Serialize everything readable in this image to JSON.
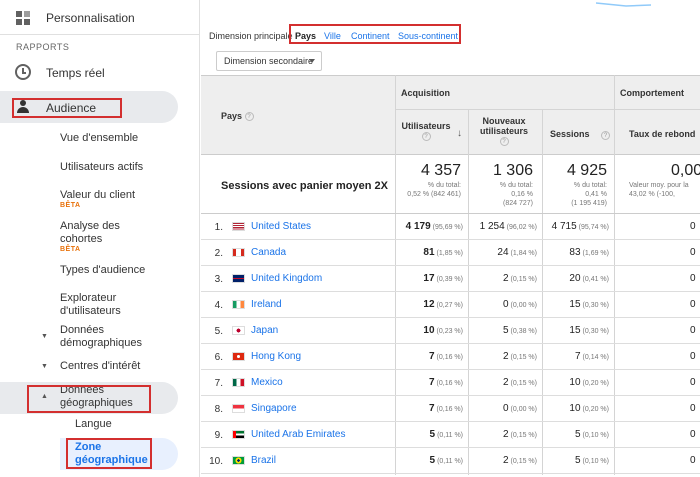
{
  "sidebar": {
    "personalisation": "Personnalisation",
    "section_rapports": "RAPPORTS",
    "temps_reel": "Temps réel",
    "audience": "Audience",
    "items": [
      {
        "label": "Vue d'ensemble"
      },
      {
        "label": "Utilisateurs actifs"
      },
      {
        "label": "Valeur du client",
        "badge": "BÊTA"
      },
      {
        "label": "Analyse des cohortes",
        "badge": "BÊTA"
      },
      {
        "label": "Types d'audience"
      },
      {
        "label": "Explorateur d'utilisateurs"
      }
    ],
    "donnees_demo": "Données démographiques",
    "centres_interet": "Centres d'intérêt",
    "donnees_geo": "Données géographiques",
    "langue": "Langue",
    "zone_geo": "Zone géographique"
  },
  "toolbar": {
    "dim_label": "Dimension principale :",
    "tabs": [
      "Pays",
      "Ville",
      "Continent",
      "Sous-continent"
    ],
    "secondary": "Dimension secondaire"
  },
  "table": {
    "col_pays": "Pays",
    "group_acquisition": "Acquisition",
    "group_comportement": "Comportement",
    "col_users": "Utilisateurs",
    "col_new_users": "Nouveaux utilisateurs",
    "col_sessions": "Sessions",
    "col_bounce": "Taux de rebond",
    "summary": {
      "label": "Sessions avec panier moyen 2X",
      "users": "4 357",
      "users_sub1": "% du total:",
      "users_sub2": "0,52 % (842 461)",
      "new_users": "1 306",
      "new_sub1": "% du total:",
      "new_sub2": "0,16 %",
      "new_sub3": "(824 727)",
      "sessions": "4 925",
      "sess_sub1": "% du total:",
      "sess_sub2": "0,41 %",
      "sess_sub3": "(1 195 419)",
      "bounce": "0,00",
      "bounce_sub1": "Valeur moy. pour la",
      "bounce_sub2": "43,02 % (-100,"
    },
    "rows": [
      {
        "n": "1.",
        "country": "United States",
        "users": "4 179",
        "users_pct": "(95,69 %)",
        "new": "1 254",
        "new_pct": "(96,02 %)",
        "sess": "4 715",
        "sess_pct": "(95,74 %)",
        "bounce": "0"
      },
      {
        "n": "2.",
        "country": "Canada",
        "users": "81",
        "users_pct": "(1,85 %)",
        "new": "24",
        "new_pct": "(1,84 %)",
        "sess": "83",
        "sess_pct": "(1,69 %)",
        "bounce": "0"
      },
      {
        "n": "3.",
        "country": "United Kingdom",
        "users": "17",
        "users_pct": "(0,39 %)",
        "new": "2",
        "new_pct": "(0,15 %)",
        "sess": "20",
        "sess_pct": "(0,41 %)",
        "bounce": "0"
      },
      {
        "n": "4.",
        "country": "Ireland",
        "users": "12",
        "users_pct": "(0,27 %)",
        "new": "0",
        "new_pct": "(0,00 %)",
        "sess": "15",
        "sess_pct": "(0,30 %)",
        "bounce": "0"
      },
      {
        "n": "5.",
        "country": "Japan",
        "users": "10",
        "users_pct": "(0,23 %)",
        "new": "5",
        "new_pct": "(0,38 %)",
        "sess": "15",
        "sess_pct": "(0,30 %)",
        "bounce": "0"
      },
      {
        "n": "6.",
        "country": "Hong Kong",
        "users": "7",
        "users_pct": "(0,16 %)",
        "new": "2",
        "new_pct": "(0,15 %)",
        "sess": "7",
        "sess_pct": "(0,14 %)",
        "bounce": "0"
      },
      {
        "n": "7.",
        "country": "Mexico",
        "users": "7",
        "users_pct": "(0,16 %)",
        "new": "2",
        "new_pct": "(0,15 %)",
        "sess": "10",
        "sess_pct": "(0,20 %)",
        "bounce": "0"
      },
      {
        "n": "8.",
        "country": "Singapore",
        "users": "7",
        "users_pct": "(0,16 %)",
        "new": "0",
        "new_pct": "(0,00 %)",
        "sess": "10",
        "sess_pct": "(0,20 %)",
        "bounce": "0"
      },
      {
        "n": "9.",
        "country": "United Arab Emirates",
        "users": "5",
        "users_pct": "(0,11 %)",
        "new": "2",
        "new_pct": "(0,15 %)",
        "sess": "5",
        "sess_pct": "(0,10 %)",
        "bounce": "0"
      },
      {
        "n": "10.",
        "country": "Brazil",
        "users": "5",
        "users_pct": "(0,11 %)",
        "new": "2",
        "new_pct": "(0,15 %)",
        "sess": "5",
        "sess_pct": "(0,10 %)",
        "bounce": "0"
      }
    ]
  },
  "colors": {
    "link": "#1a73e8",
    "highlight_box": "#d32f2f",
    "beta": "#e8710a"
  },
  "icons": [
    "dashboard-icon",
    "clock-icon",
    "person-icon",
    "help-icon",
    "sort-down-icon",
    "chevron-down-icon"
  ]
}
